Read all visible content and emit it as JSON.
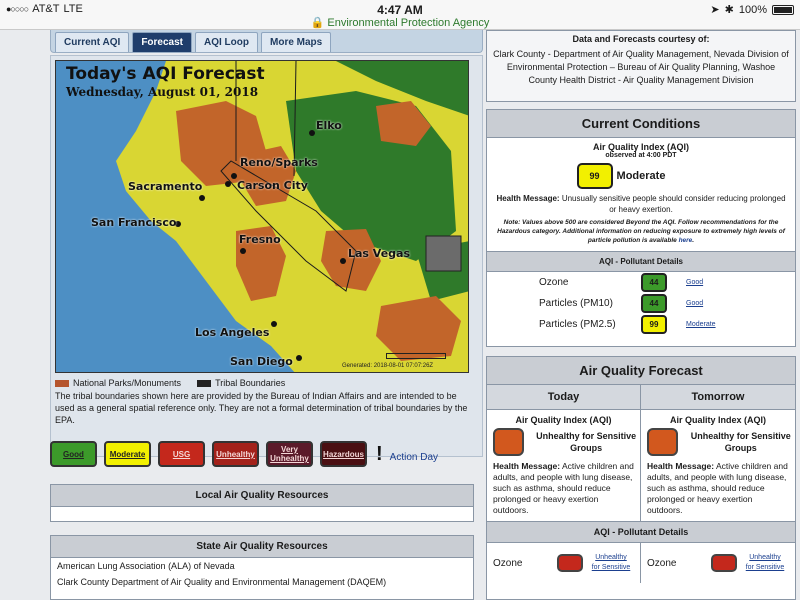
{
  "status_bar": {
    "carrier": "AT&T",
    "network": "LTE",
    "time": "4:47 AM",
    "site": "Environmental Protection Agency",
    "battery": "100%"
  },
  "tabs": [
    "Current AQI",
    "Forecast",
    "AQI Loop",
    "More Maps"
  ],
  "active_tab": "Forecast",
  "map": {
    "title": "Today's AQI Forecast",
    "date": "Wednesday, August 01, 2018",
    "cities": [
      "Elko",
      "Reno/Sparks",
      "Carson City",
      "Sacramento",
      "San Francisco",
      "Fresno",
      "Las Vegas",
      "Los Angeles",
      "San Diego"
    ],
    "credit": "Generated: 2018-08-01 07:07:26Z",
    "legend": [
      {
        "label": "National Parks/Monuments",
        "color": "#b5552e"
      },
      {
        "label": "Tribal Boundaries",
        "color": "#222222"
      }
    ],
    "note": "The tribal boundaries shown here are provided by the Bureau of Indian Affairs and are intended to be used as a general spatial reference only. They are not a formal determination of tribal boundaries by the EPA."
  },
  "aqi_scale": [
    {
      "label": "Good",
      "color": "#3c9a2a",
      "text": "#222222"
    },
    {
      "label": "Moderate",
      "color": "#f2f000",
      "text": "#222222"
    },
    {
      "label": "USG",
      "color": "#c4281c",
      "text": "#f4d7d7"
    },
    {
      "label": "Unhealthy",
      "color": "#a3211a",
      "text": "#f4d7d7"
    },
    {
      "label": "Very Unhealthy",
      "color": "#5b1a2a",
      "text": "#f4d7d7"
    },
    {
      "label": "Hazardous",
      "color": "#4a0f12",
      "text": "#f4d7d7"
    }
  ],
  "action_day": "Action Day",
  "local_resources": {
    "title": "Local Air Quality Resources"
  },
  "state_resources": {
    "title": "State Air Quality Resources",
    "items": [
      "American Lung Association (ALA) of Nevada",
      "Clark County Department of Air Quality and Environmental Management (DAQEM)"
    ]
  },
  "credits": {
    "title": "Data and Forecasts courtesy of:",
    "text": "Clark County - Department of Air Quality Management, Nevada Division of Environmental Protection – Bureau of Air Quality Planning, Washoe County Health District - Air Quality Management Division"
  },
  "current": {
    "title": "Current Conditions",
    "aqi_label": "Air Quality Index (AQI)",
    "observed": "observed at 4:00 PDT",
    "value": "99",
    "category": "Moderate",
    "color": "#f2f000",
    "health_label": "Health Message:",
    "health": "Unusually sensitive people should consider reducing prolonged or heavy exertion.",
    "note_text": "Note: Values above 500 are considered Beyond the AQI. Follow recommendations for the Hazardous category. Additional information on reducing exposure to extremely high levels of particle pollution is available ",
    "note_link": "here",
    "pollutant_head": "AQI - Pollutant Details",
    "pollutants": [
      {
        "name": "Ozone",
        "value": "44",
        "category": "Good",
        "color": "#3c9a2a"
      },
      {
        "name": "Particles (PM10)",
        "value": "44",
        "category": "Good",
        "color": "#3c9a2a"
      },
      {
        "name": "Particles (PM2.5)",
        "value": "99",
        "category": "Moderate",
        "color": "#f2f000"
      }
    ]
  },
  "forecast": {
    "title": "Air Quality Forecast",
    "days": [
      {
        "day": "Today",
        "aqi_label": "Air Quality Index (AQI)",
        "category": "Unhealthy for Sensitive Groups",
        "color": "#d2581e",
        "health_label": "Health Message:",
        "health": "Active children and adults, and people with lung disease, such as asthma, should reduce prolonged or heavy exertion outdoors."
      },
      {
        "day": "Tomorrow",
        "aqi_label": "Air Quality Index (AQI)",
        "category": "Unhealthy for Sensitive Groups",
        "color": "#d2581e",
        "health_label": "Health Message:",
        "health": "Active children and adults, and people with lung disease, such as asthma, should reduce prolonged or heavy exertion outdoors."
      }
    ],
    "pollutant_head": "AQI - Pollutant Details",
    "pollutants": [
      {
        "name": "Ozone",
        "category": "Unhealthy for Sensitive",
        "color": "#c4281c"
      },
      {
        "name": "Ozone",
        "category": "Unhealthy for Sensitive",
        "color": "#c4281c"
      }
    ]
  }
}
